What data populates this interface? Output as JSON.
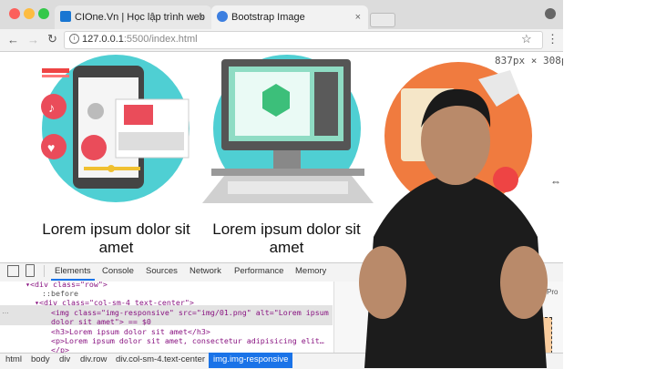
{
  "browser": {
    "tabs": [
      {
        "label": "CIOne.Vn | Học lập trình web",
        "close": "×"
      },
      {
        "label": "Bootstrap Image",
        "close": "×"
      }
    ],
    "url_host": "127.0.0.1",
    "url_path": ":5500/index.html",
    "icons": [
      "back-icon",
      "forward-icon",
      "reload-icon",
      "star-icon",
      "menu-icon",
      "profile-icon"
    ]
  },
  "page": {
    "size_tooltip": "837px × 308p",
    "captions": [
      "Lorem ipsum dolor sit amet",
      "Lorem ipsum dolor sit amet"
    ]
  },
  "devtools": {
    "tabs": [
      "Elements",
      "Console",
      "Sources",
      "Network",
      "Performance",
      "Memory"
    ],
    "code_lines": [
      {
        "text": "▾<div class=\"row\">"
      },
      {
        "text": "::before"
      },
      {
        "text": "▾<div class=\"col-sm-4 text-center\">"
      },
      {
        "text": "<img class=\"img-responsive\" src=\"img/01.png\" alt=\"Lorem ipsum"
      },
      {
        "text": "dolor sit amet\"> == $0"
      },
      {
        "text": "<h3>Lorem ipsum dolor sit amet</h3>"
      },
      {
        "text": "<p>Lorem ipsum dolor sit amet, consectetur adipisicing elit…"
      },
      {
        "text": "</p>"
      }
    ],
    "breadcrumbs": [
      "html",
      "body",
      "div",
      "div.row",
      "div.col-sm-4.text-center",
      "img.img-responsive"
    ],
    "styles_snip": "Pro"
  },
  "colors": {
    "accent": "#1a73e8",
    "teal": "#4fcfd3",
    "orange": "#f07b3f"
  }
}
